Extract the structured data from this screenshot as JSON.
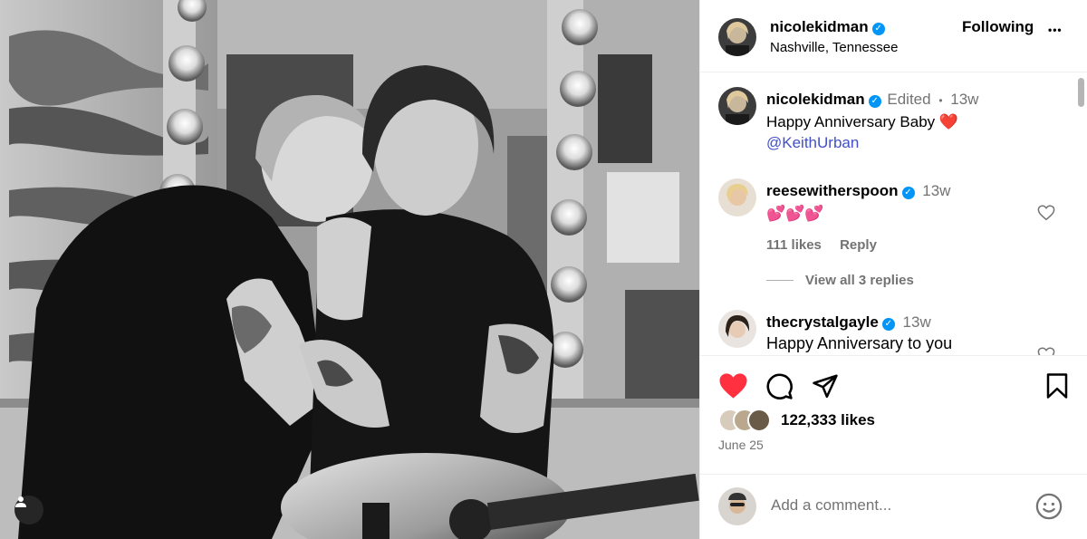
{
  "post": {
    "author": "nicolekidman",
    "location": "Nashville, Tennessee",
    "follow_label": "Following",
    "more_label": "•••",
    "caption": {
      "username": "nicolekidman",
      "edited": "Edited",
      "dot": "•",
      "time": "13w",
      "text": "Happy Anniversary Baby",
      "emoji": "❤️",
      "mention": "@KeithUrban"
    },
    "comments": [
      {
        "username": "reesewitherspoon",
        "time": "13w",
        "text": "💕💕💕",
        "likes": "111 likes",
        "reply_label": "Reply"
      },
      {
        "username": "thecrystalgayle",
        "time": "13w",
        "text": "Happy Anniversary to you"
      }
    ],
    "view_replies_label": "View all 3 replies",
    "likes": "122,333 likes",
    "date": "June 25",
    "add_comment_placeholder": "Add a comment...",
    "liked": true
  },
  "colors": {
    "like_red": "#ff3040",
    "verified_blue": "#0095f6",
    "mention_blue": "#4150c7"
  },
  "icons": [
    "heart-icon",
    "comment-icon",
    "share-icon",
    "bookmark-icon",
    "emoji-icon",
    "user-tag-icon",
    "verified-icon",
    "more-icon"
  ]
}
